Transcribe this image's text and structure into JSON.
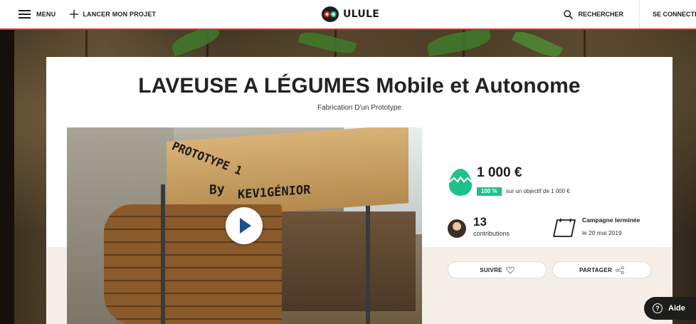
{
  "nav": {
    "menu_label": "MENU",
    "launch_label": "LANCER MON PROJET",
    "logo_text": "ULULE",
    "search_label": "RECHERCHER",
    "login_label": "SE CONNECTER",
    "accent_color": "#e22f2a"
  },
  "project": {
    "title": "LAVEUSE A LÉGUMES Mobile et Autonome",
    "subtitle": "Fabrication D'un Prototype",
    "video_text_1": "PROTOTYPE 1",
    "video_text_2": "By",
    "video_text_3": "KEV1GÉNIOR"
  },
  "stats": {
    "amount": "1 000 €",
    "percent": "100 %",
    "goal_text": "sur un objectif de 1 000 €",
    "progress_fraction": 1.0,
    "contributions_count": "13",
    "contributions_label": "contributions",
    "campaign_status": "Campagne terminée",
    "campaign_date": "le 20 mai 2019",
    "success_color": "#1ec18c"
  },
  "actions": {
    "follow_label": "SUIVRE",
    "share_label": "PARTAGER"
  },
  "help": {
    "label": "Aide",
    "icon_glyph": "?"
  },
  "icons": [
    "hamburger-icon",
    "plus-icon",
    "owl-logo-icon",
    "search-icon",
    "play-icon",
    "egg-icon",
    "avatar",
    "calendar-icon",
    "heart-icon",
    "share-icon",
    "help-icon"
  ]
}
